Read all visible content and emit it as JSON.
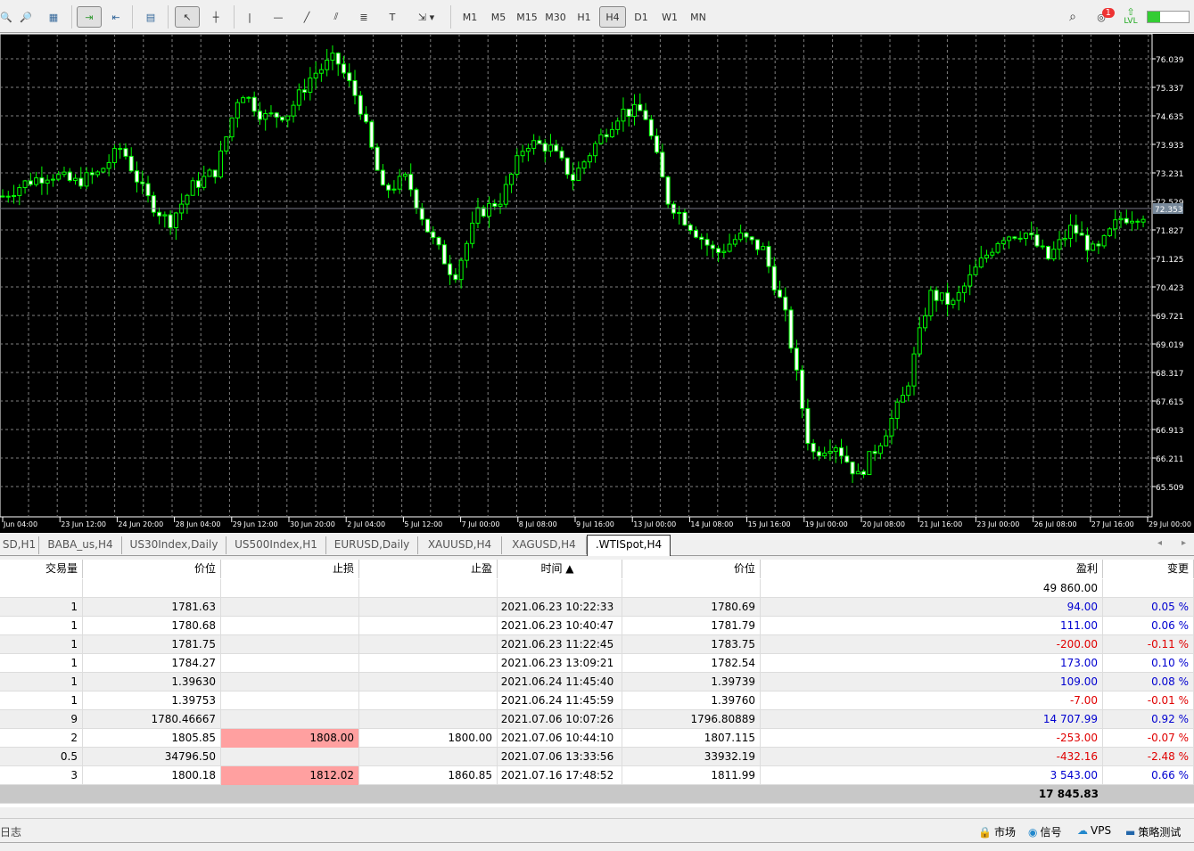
{
  "toolbar": {
    "timeframes": [
      "M1",
      "M5",
      "M15",
      "M30",
      "H1",
      "H4",
      "D1",
      "W1",
      "MN"
    ],
    "active_timeframe": "H4",
    "notification_count": "1",
    "lvl_label": "LVL",
    "signal_strength": 0.3
  },
  "chart": {
    "symbol": ".WTISpot,H4",
    "bull_color": "#00ff00",
    "grid_color": "#808080",
    "price_ticks": [
      "76.039",
      "75.337",
      "74.635",
      "73.933",
      "73.231",
      "72.529",
      "71.827",
      "71.125",
      "70.423",
      "69.721",
      "69.019",
      "68.317",
      "67.615",
      "66.913",
      "66.211",
      "65.509"
    ],
    "current_price": "72.353",
    "time_ticks": [
      "Jun 04:00",
      "23 Jun 12:00",
      "24 Jun 20:00",
      "28 Jun 04:00",
      "29 Jun 12:00",
      "30 Jun 20:00",
      "2 Jul 04:00",
      "5 Jul 12:00",
      "7 Jul 00:00",
      "8 Jul 08:00",
      "9 Jul 16:00",
      "13 Jul 00:00",
      "14 Jul 08:00",
      "15 Jul 16:00",
      "19 Jul 00:00",
      "20 Jul 08:00",
      "21 Jul 16:00",
      "23 Jul 00:00",
      "26 Jul 08:00",
      "27 Jul 16:00",
      "29 Jul 00:00"
    ],
    "closes": [
      72.66,
      73.0,
      73.21,
      72.99,
      73.2,
      73.87,
      72.66,
      72.0,
      72.9,
      73.3,
      75.29,
      74.6,
      74.7,
      75.62,
      76.06,
      74.96,
      72.77,
      73.1,
      71.67,
      70.68,
      72.22,
      72.6,
      73.98,
      73.87,
      73.1,
      73.98,
      74.74,
      74.74,
      72.55,
      71.9,
      71.23,
      71.67,
      71.34,
      69.59,
      66.3,
      66.6,
      65.75,
      66.7,
      67.83,
      70.25,
      70.0,
      70.9,
      71.67,
      71.78,
      71.12,
      71.9,
      71.23,
      72.11,
      72.22
    ]
  },
  "tabs": [
    "SD,H1",
    "BABA_us,H4",
    "US30Index,Daily",
    "US500Index,H1",
    "EURUSD,Daily",
    "XAUUSD,H4",
    "XAGUSD,H4",
    ".WTISpot,H4"
  ],
  "table": {
    "headers": [
      "交易量",
      "价位",
      "止损",
      "止盈",
      "时间 ▲",
      "价位",
      "盈利",
      "变更"
    ],
    "balance": "49 860.00",
    "rows": [
      [
        "1",
        "1781.63",
        "",
        "",
        "2021.06.23 10:22:33",
        "1780.69",
        "94.00",
        "0.05 %"
      ],
      [
        "1",
        "1780.68",
        "",
        "",
        "2021.06.23 10:40:47",
        "1781.79",
        "111.00",
        "0.06 %"
      ],
      [
        "1",
        "1781.75",
        "",
        "",
        "2021.06.23 11:22:45",
        "1783.75",
        "-200.00",
        "-0.11 %"
      ],
      [
        "1",
        "1784.27",
        "",
        "",
        "2021.06.23 13:09:21",
        "1782.54",
        "173.00",
        "0.10 %"
      ],
      [
        "1",
        "1.39630",
        "",
        "",
        "2021.06.24 11:45:40",
        "1.39739",
        "109.00",
        "0.08 %"
      ],
      [
        "1",
        "1.39753",
        "",
        "",
        "2021.06.24 11:45:59",
        "1.39760",
        "-7.00",
        "-0.01 %"
      ],
      [
        "9",
        "1780.46667",
        "",
        "",
        "2021.07.06 10:07:26",
        "1796.80889",
        "14 707.99",
        "0.92 %"
      ],
      [
        "2",
        "1805.85",
        "1808.00",
        "1800.00",
        "2021.07.06 10:44:10",
        "1807.115",
        "-253.00",
        "-0.07 %"
      ],
      [
        "0.5",
        "34796.50",
        "",
        "",
        "2021.07.06 13:33:56",
        "33932.19",
        "-432.16",
        "-2.48 %"
      ],
      [
        "3",
        "1800.18",
        "1812.02",
        "1860.85",
        "2021.07.16 17:48:52",
        "1811.99",
        "3 543.00",
        "0.66 %"
      ]
    ],
    "total": "17 845.83"
  },
  "statusbar": {
    "log_tab": "日志",
    "market": "市场",
    "signals": "信号",
    "vps": "VPS",
    "tester": "策略测试"
  }
}
